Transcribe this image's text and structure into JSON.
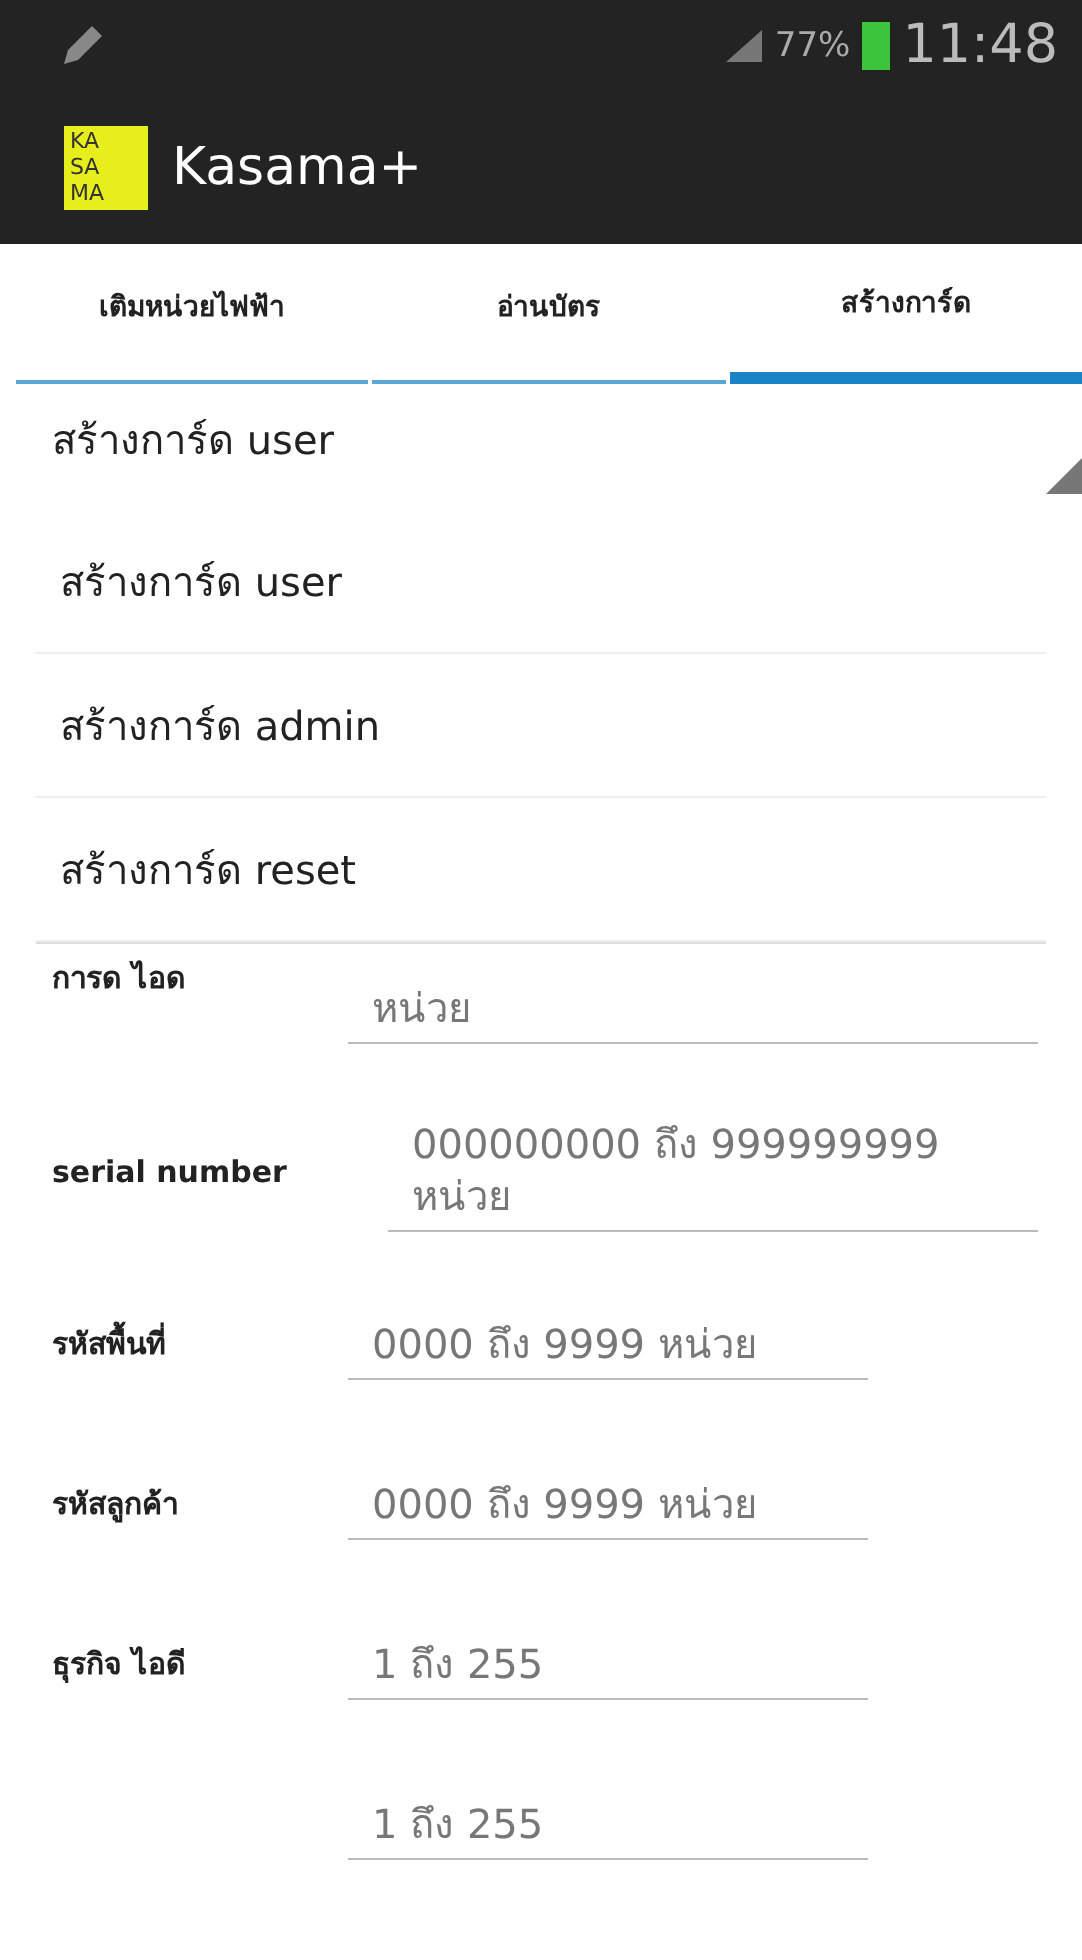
{
  "status_bar": {
    "battery": "77%",
    "time": "11:48"
  },
  "app_bar": {
    "logo_lines": [
      "KA",
      "SA",
      "MA"
    ],
    "title": "Kasama+"
  },
  "tabs": [
    {
      "label": "เติมหน่วยไฟฟ้า",
      "selected": false
    },
    {
      "label": "อ่านบัตร",
      "selected": false
    },
    {
      "label": "สร้างการ์ด",
      "selected": true
    }
  ],
  "spinner": {
    "value": "สร้างการ์ด user"
  },
  "dropdown": {
    "items": [
      {
        "label": "สร้างการ์ด user"
      },
      {
        "label": "สร้างการ์ด admin"
      },
      {
        "label": "สร้างการ์ด  reset"
      }
    ]
  },
  "form": {
    "fields": [
      {
        "label": "การด ไอด",
        "placeholder": "หน่วย"
      },
      {
        "label": "serial number",
        "placeholder": "000000000 ถึง 999999999 หน่วย"
      },
      {
        "label": "รหัสพื้นที่",
        "placeholder": "0000 ถึง  9999 หน่วย"
      },
      {
        "label": "รหัสลูกค้า",
        "placeholder": "0000 ถึง 9999 หน่วย"
      },
      {
        "label": "ธุรกิจ ไอดี",
        "placeholder": "1 ถึง 255"
      },
      {
        "placeholder": "1 ถึง 255"
      }
    ]
  }
}
